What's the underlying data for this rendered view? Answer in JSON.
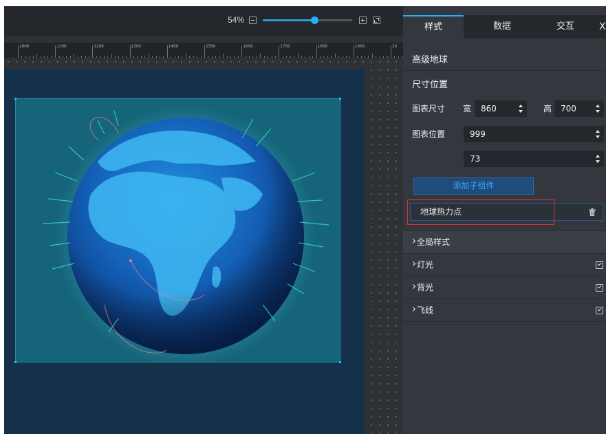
{
  "canvas": {
    "zoom_label": "54%",
    "zoom_percent": 54,
    "ruler_labels": [
      "1000",
      "1100",
      "1200",
      "1300",
      "1400",
      "1500",
      "1600",
      "1700",
      "1800",
      "1900",
      "20"
    ]
  },
  "panel": {
    "tabs": [
      "样式",
      "数据",
      "交互"
    ],
    "close_label": "X",
    "widget_name": "高级地球",
    "size_section": "尺寸位置",
    "chart_size_label": "图表尺寸",
    "width_label": "宽",
    "width_value": "860",
    "height_label": "高",
    "height_value": "700",
    "chart_position_label": "图表位置",
    "pos_x_value": "999",
    "pos_y_value": "73",
    "add_child_label": "添加子组件",
    "child_item_label": "地球热力点",
    "sections": [
      "全局样式",
      "灯光",
      "背光",
      "飞线"
    ]
  },
  "colors": {
    "accent": "#27aef5",
    "highlight_border": "#e0332f",
    "board": "#14304a",
    "globe_frame": "#156479"
  }
}
